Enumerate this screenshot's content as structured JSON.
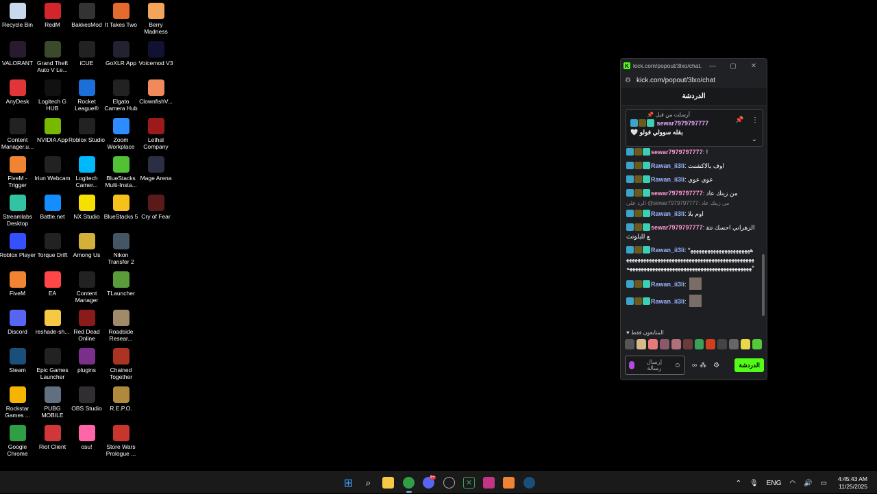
{
  "desktop": {
    "icons": [
      {
        "label": "Recycle Bin",
        "icon": "recycle-bin-icon",
        "color": "#c9d8ee"
      },
      {
        "label": "VALORANT",
        "icon": "valorant-icon",
        "color": "#2a1a2e"
      },
      {
        "label": "AnyDesk",
        "icon": "anydesk-icon",
        "color": "#e0363a"
      },
      {
        "label": "Content Manager.u...",
        "icon": "content-manager-icon",
        "color": "#222"
      },
      {
        "label": "FiveM - Trigger",
        "icon": "fivem-icon",
        "color": "#f08433"
      },
      {
        "label": "Streamlabs Desktop",
        "icon": "streamlabs-icon",
        "color": "#31c3a2"
      },
      {
        "label": "Roblox Player",
        "icon": "roblox-icon",
        "color": "#3550ff"
      },
      {
        "label": "FiveM",
        "icon": "fivem-icon",
        "color": "#f08433"
      },
      {
        "label": "Discord",
        "icon": "discord-icon",
        "color": "#5865f2"
      },
      {
        "label": "Steam",
        "icon": "steam-icon",
        "color": "#1a4f7a"
      },
      {
        "label": "Rockstar Games ...",
        "icon": "rockstar-icon",
        "color": "#f5b400"
      },
      {
        "label": "Google Chrome",
        "icon": "chrome-icon",
        "color": "#2f9e44"
      },
      {
        "label": "RedM",
        "icon": "redm-icon",
        "color": "#d3252b"
      },
      {
        "label": "Grand Theft Auto V Le...",
        "icon": "gta-icon",
        "color": "#3b4a2a"
      },
      {
        "label": "Logitech G HUB",
        "icon": "ghub-icon",
        "color": "#111"
      },
      {
        "label": "NVIDIA App",
        "icon": "nvidia-icon",
        "color": "#76b900"
      },
      {
        "label": "Iriun Webcam",
        "icon": "iriun-icon",
        "color": "#222"
      },
      {
        "label": "Battle.net",
        "icon": "battlenet-icon",
        "color": "#148eff"
      },
      {
        "label": "Torque Drift",
        "icon": "torque-drift-icon",
        "color": "#222"
      },
      {
        "label": "EA",
        "icon": "ea-icon",
        "color": "#ff4747"
      },
      {
        "label": "reshade-sh...",
        "icon": "folder-icon",
        "color": "#f6c945"
      },
      {
        "label": "Epic Games Launcher",
        "icon": "epic-icon",
        "color": "#222"
      },
      {
        "label": "PUBG MOBILE",
        "icon": "pubg-icon",
        "color": "#607080"
      },
      {
        "label": "Riot Client",
        "icon": "riot-icon",
        "color": "#d13639"
      },
      {
        "label": "BakkesMod",
        "icon": "bakkesmod-icon",
        "color": "#333"
      },
      {
        "label": "iCUE",
        "icon": "icue-icon",
        "color": "#222"
      },
      {
        "label": "Rocket League®",
        "icon": "rocket-league-icon",
        "color": "#1b6fd6"
      },
      {
        "label": "Roblox Studio",
        "icon": "roblox-studio-icon",
        "color": "#222"
      },
      {
        "label": "Logitech Camer...",
        "icon": "logitech-camera-icon",
        "color": "#00b8fc"
      },
      {
        "label": "NX Studio",
        "icon": "nx-studio-icon",
        "color": "#f5e000"
      },
      {
        "label": "Among Us",
        "icon": "among-us-icon",
        "color": "#d4af3a"
      },
      {
        "label": "Content Manager",
        "icon": "content-manager-icon",
        "color": "#222"
      },
      {
        "label": "Red Dead Online",
        "icon": "rdo-icon",
        "color": "#8b1a1a"
      },
      {
        "label": "plugins",
        "icon": "winrar-icon",
        "color": "#7a2f8a"
      },
      {
        "label": "OBS Studio",
        "icon": "obs-icon",
        "color": "#302e31"
      },
      {
        "label": "osu!",
        "icon": "osu-icon",
        "color": "#ff66aa"
      },
      {
        "label": "It Takes Two",
        "icon": "it-takes-two-icon",
        "color": "#e56a2e"
      },
      {
        "label": "GoXLR App",
        "icon": "goxlr-icon",
        "color": "#223"
      },
      {
        "label": "Elgato Camera Hub",
        "icon": "elgato-icon",
        "color": "#222"
      },
      {
        "label": "Zoom Workplace",
        "icon": "zoom-icon",
        "color": "#2d8cff"
      },
      {
        "label": "BlueStacks Multi-Insta...",
        "icon": "bluestacks-icon",
        "color": "#52c234"
      },
      {
        "label": "BlueStacks 5",
        "icon": "bluestacks-icon",
        "color": "#f7c11b"
      },
      {
        "label": "Nikon Transfer 2",
        "icon": "nikon-icon",
        "color": "#445566"
      },
      {
        "label": "TLauncher",
        "icon": "tlauncher-icon",
        "color": "#5a9b3a"
      },
      {
        "label": "Roadside Resear...",
        "icon": "roadside-icon",
        "color": "#a08a6a"
      },
      {
        "label": "Chained Together",
        "icon": "chained-together-icon",
        "color": "#aa3322"
      },
      {
        "label": "R.E.P.O.",
        "icon": "repo-icon",
        "color": "#b08a3a"
      },
      {
        "label": "Store Wars Prologue ...",
        "icon": "store-wars-icon",
        "color": "#c8352d"
      },
      {
        "label": "Berry Madness",
        "icon": "berry-madness-icon",
        "color": "#f4a35a"
      },
      {
        "label": "Voicemod V3",
        "icon": "voicemod-icon",
        "color": "#113"
      },
      {
        "label": "ClownfishV...",
        "icon": "clownfish-icon",
        "color": "#f08a5d"
      },
      {
        "label": "Lethal Company",
        "icon": "lethal-company-icon",
        "color": "#9b1b1b"
      },
      {
        "label": "Mage Arena",
        "icon": "mage-arena-icon",
        "color": "#2a2f44"
      },
      {
        "label": "Cry of Fear",
        "icon": "cry-of-fear-icon",
        "color": "#5a1a1a"
      }
    ]
  },
  "chatwin": {
    "title": "kick.com/popout/3lxo/chat...",
    "address": "kick.com/popout/3lxo/chat",
    "header": "الدردشة",
    "pinned": {
      "header": "أرسلت من قبل",
      "user": "sewar7979797777",
      "message": "🤍 ‎بقله سوولي فولو"
    },
    "messages": [
      {
        "user": "sewar7979797777",
        "color": "pink",
        "text": "!"
      },
      {
        "user": "Rawan_ii3li",
        "color": "blue",
        "text": "اوف يالاكشنت"
      },
      {
        "user": "Rawan_ii3li",
        "color": "blue",
        "text": "عوي عوي"
      },
      {
        "user": "sewar7979797777",
        "color": "pink",
        "text": "من زينك عاد"
      },
      {
        "user": "Rawan_ii3li",
        "color": "blue",
        "text": "اوم بلا",
        "reply": "الرد على @sewar7979797777: من زينك عاد"
      },
      {
        "user": "sewar7979797777",
        "color": "pink",
        "text": "الزهراني احسك تتفع للبلوتث"
      },
      {
        "user": "Rawan_ii3li",
        "color": "blue",
        "text": "*ههههههههههههههههههههههههههههههههههههههههههههههههههههههههههههههههههههههههههههههههههههههههههههههههههههههههههههههه*"
      },
      {
        "user": "Rawan_ii3li",
        "color": "blue",
        "text": ""
      },
      {
        "user": "Rawan_ii3li",
        "color": "blue",
        "text": ""
      }
    ],
    "followers_only": "المتابعون فقط",
    "input_placeholder": "إرسال رسالة",
    "send_label": "الدردشة"
  },
  "taskbar": {
    "lang": "ENG",
    "time": "4:45:43 AM",
    "date": "11/25/2025",
    "discord_badge": "9+"
  },
  "colors": {
    "kick_green": "#53fc18",
    "pink_user": "#ff9ad5",
    "blue_user": "#9ab4ff"
  }
}
